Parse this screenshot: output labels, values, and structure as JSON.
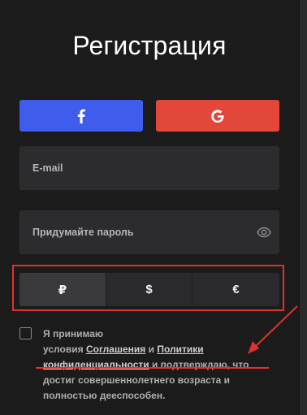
{
  "header": {
    "title": "Регистрация"
  },
  "social": {
    "facebook_glyph": "f",
    "google_glyph": "G",
    "facebook_color": "#3f5ced",
    "google_color": "#e3473a"
  },
  "form": {
    "email_placeholder": "E-mail",
    "password_placeholder": "Придумайте пароль",
    "password_icon": "eye-icon"
  },
  "currencies": {
    "options": [
      "₽",
      "$",
      "€"
    ],
    "selected": "₽"
  },
  "consent": {
    "text_1": "Я принимаю",
    "text_2": "условия",
    "link_agreement": "Соглашения",
    "text_and": "и",
    "link_policy_1": "Политики",
    "link_policy_2": "конфиденциальности",
    "text_3": "и подтверждаю",
    "text_4": ", что",
    "text_5": "достиг совершеннолетнего возраста и",
    "text_6": "полностью дееспособен."
  },
  "annotation": {
    "color": "#e0322b"
  }
}
